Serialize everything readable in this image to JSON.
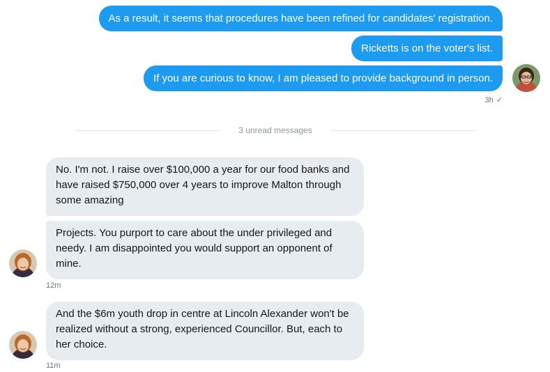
{
  "outgoing": [
    {
      "text": "As a result, it seems that procedures have been refined for candidates' registration."
    },
    {
      "text": "Ricketts is on the voter's list."
    },
    {
      "text": "If you are curious to know, I am pleased to provide background in person."
    }
  ],
  "outgoing_meta": {
    "time": "3h",
    "status_icon": "checkmark-icon"
  },
  "divider": {
    "label": "3 unread messages"
  },
  "incoming": [
    {
      "text": "No. I'm not. I raise over $100,000 a year for our food banks and have raised $750,000 over 4 years to improve Malton through some amazing"
    },
    {
      "text": "Projects. You purport to care about the under privileged and needy. I am disappointed you would support an opponent of mine."
    },
    {
      "text": "And the $6m youth drop in centre at Lincoln Alexander won't be realized without a strong, experienced Councillor. But, each to her choice."
    }
  ],
  "incoming_meta": [
    {
      "time": "12m"
    },
    {
      "time": "11m"
    }
  ],
  "colors": {
    "outgoing_bubble": "#1d9bf0",
    "incoming_bubble": "#e6ecf0",
    "meta_text": "#657786"
  }
}
